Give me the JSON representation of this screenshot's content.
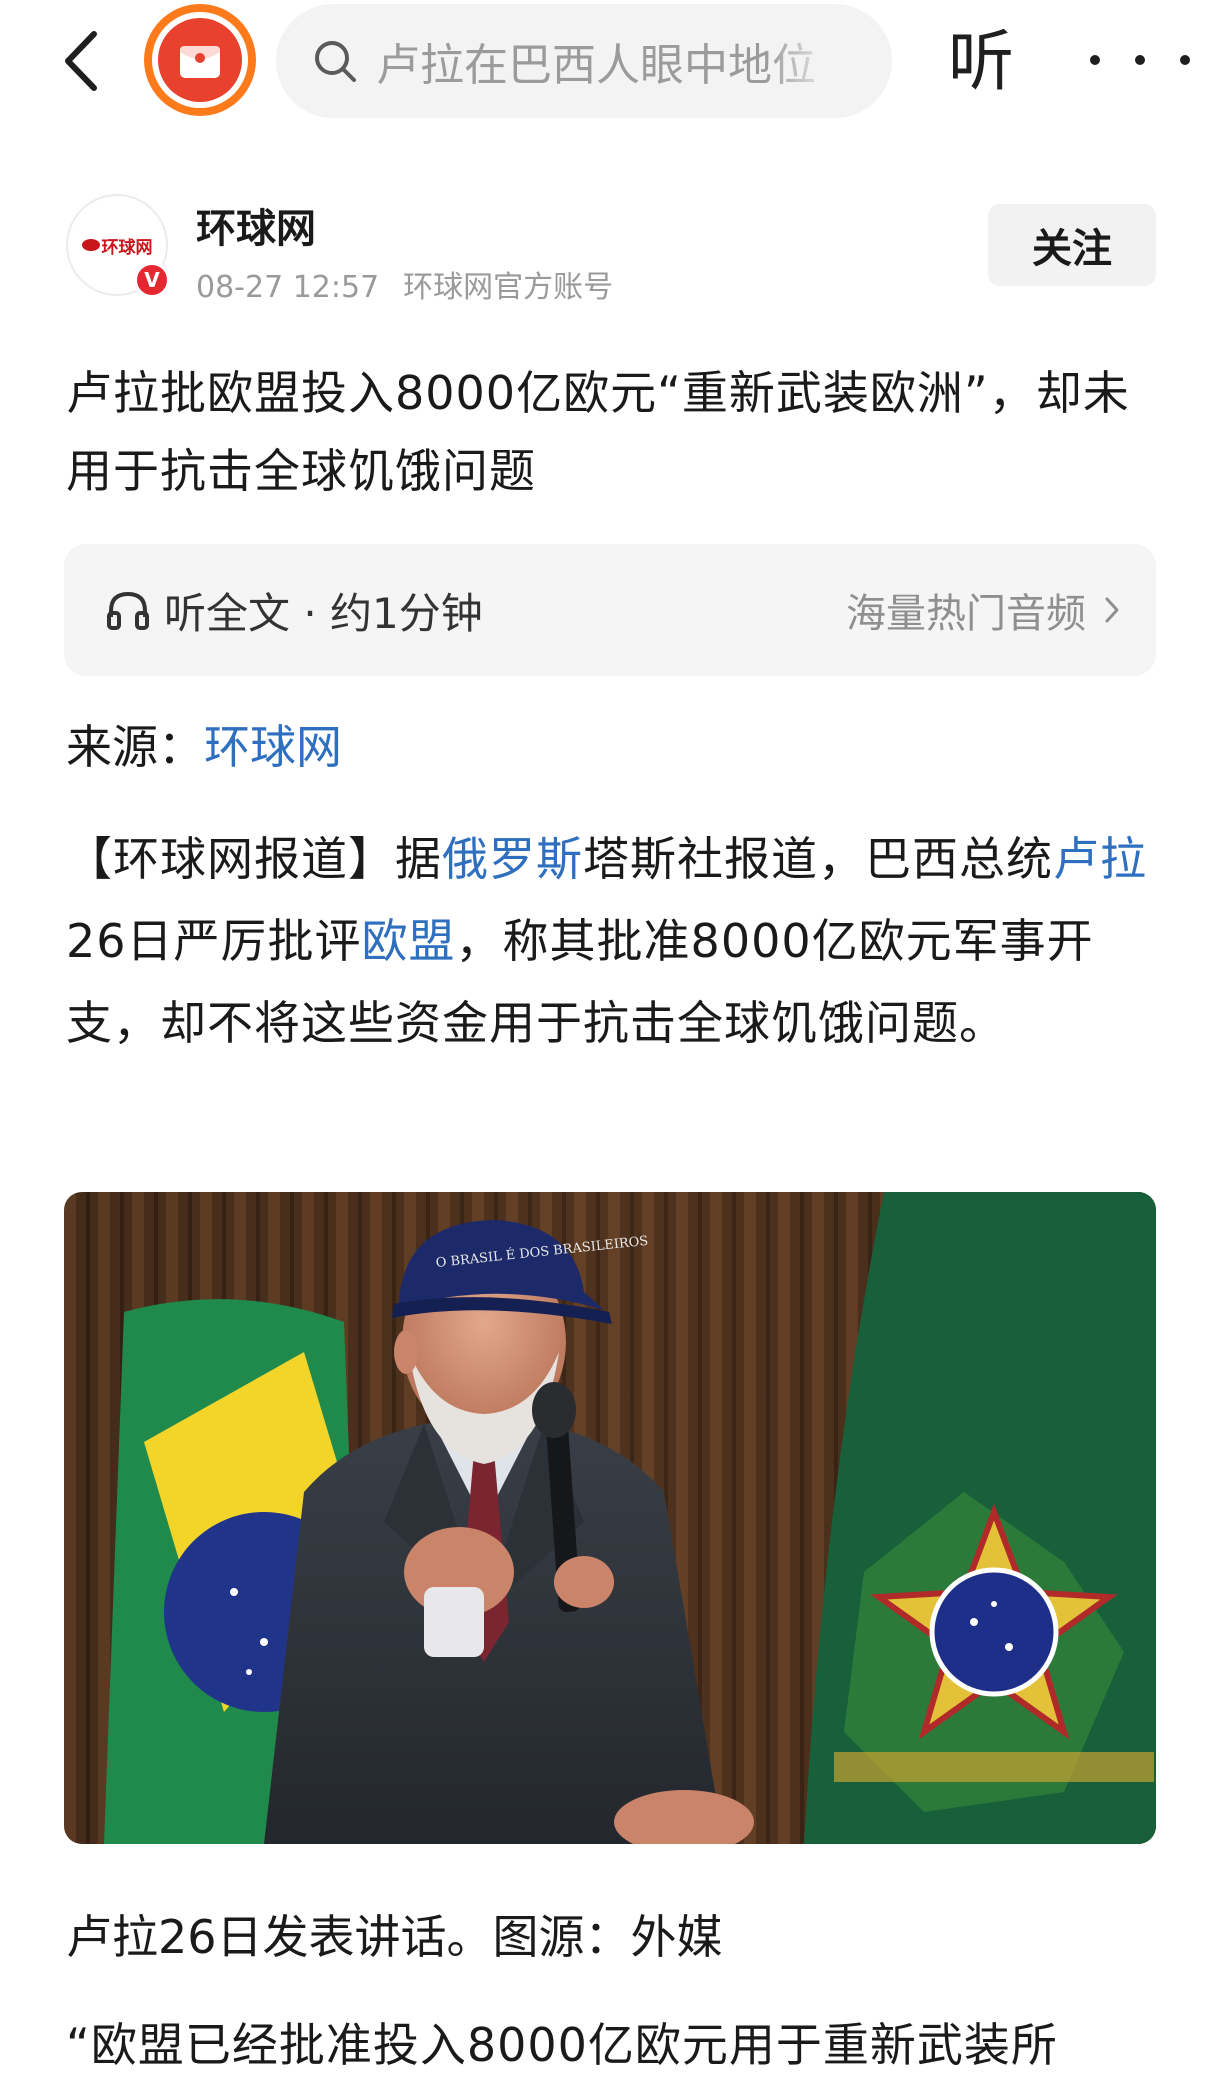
{
  "topbar": {
    "search_placeholder": "卢拉在巴西人眼中地位",
    "listen_label": "听",
    "back_icon": "chevron-left-icon",
    "redpacket_icon": "red-envelope-icon",
    "search_icon": "search-icon",
    "more_icon": "more-dots-icon",
    "redpacket_color": "#ff7a1a"
  },
  "author": {
    "name": "环球网",
    "date": "08-27 12:57",
    "account_type": "环球网官方账号",
    "verified_badge": "V",
    "avatar_logo_text": "环球网",
    "follow_label": "关注"
  },
  "article": {
    "title": "卢拉批欧盟投入8000亿欧元“重新武装欧洲”，却未用于抗击全球饥饿问题",
    "audio": {
      "listen_full": "听全文 · 约1分钟",
      "more_audio": "海量热门音频",
      "headphone_icon": "headphones-icon",
      "chevron_icon": "chevron-right-icon"
    },
    "source_label": "来源：",
    "source_link": "环球网",
    "paragraph": {
      "p1": "【环球网报道】据",
      "link1": "俄罗斯",
      "p2": "塔斯社报道，巴西总统",
      "link2": "卢拉",
      "p3": "26日严厉批评",
      "link3": "欧盟",
      "p4": "，称其批准8000亿欧元军事开支，却不将这些资金用于抗击全球饥饿问题。"
    },
    "image_cap_text": "O BRASIL É DOS BRASILEIROS",
    "caption": "卢拉26日发表讲话。图源：外媒",
    "quote_start": "“欧盟已经批准投入8000亿欧元用于重新武装所"
  },
  "colors": {
    "link": "#2f6fbf",
    "verified": "#e3282f",
    "text": "#1a1a1a",
    "muted": "#9a9a9a"
  }
}
